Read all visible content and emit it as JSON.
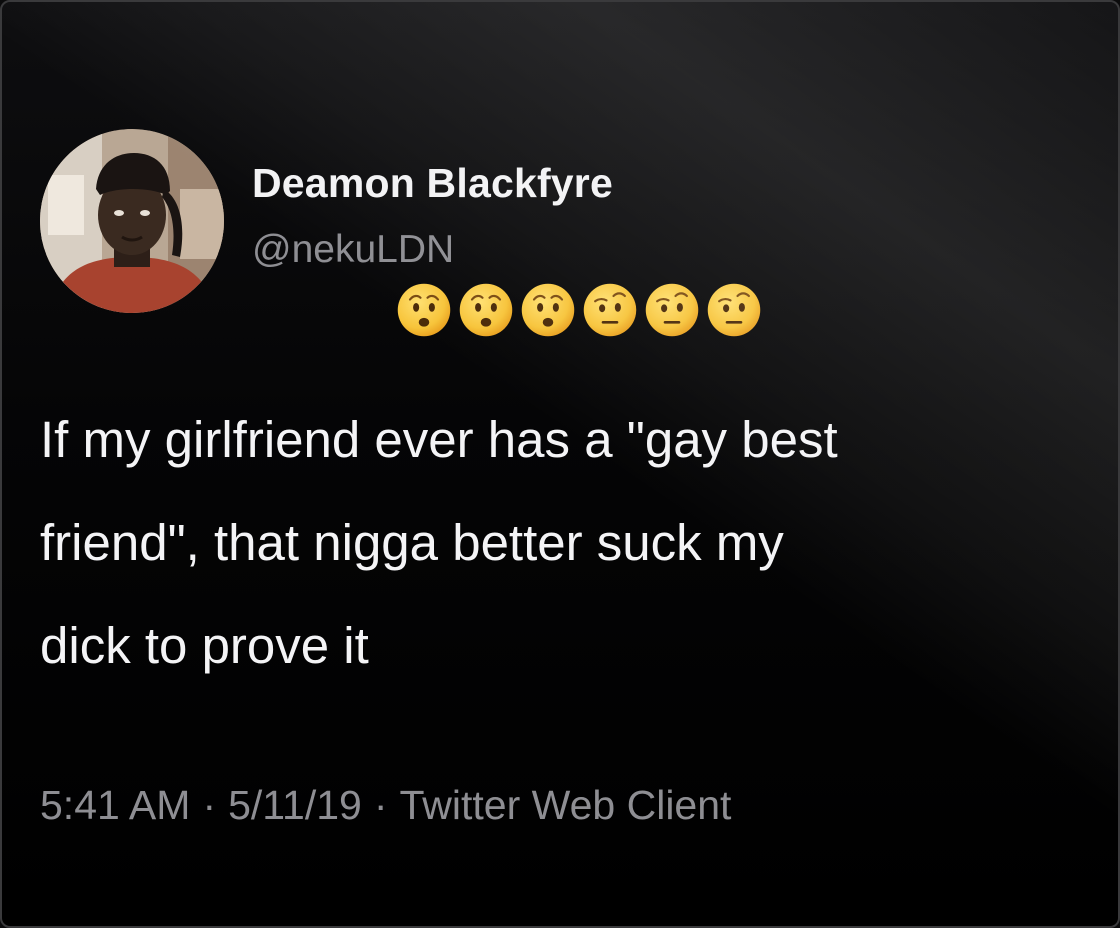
{
  "tweet": {
    "author": {
      "display_name": "Deamon Blackfyre",
      "handle": "@nekuLDN"
    },
    "emoji": [
      "hushed-face-emoji",
      "hushed-face-emoji",
      "hushed-face-emoji",
      "face-with-raised-eyebrow-emoji",
      "face-with-raised-eyebrow-emoji",
      "face-with-raised-eyebrow-emoji"
    ],
    "text": "If my girlfriend ever has a \"gay best\nfriend\", that nigga better suck my\ndick to prove it",
    "meta": {
      "time": "5:41 AM",
      "date": "5/11/19",
      "source": "Twitter Web Client",
      "separator": "·"
    }
  },
  "colors": {
    "background": "#000000",
    "text": "#f4f4f6",
    "secondary_text": "#8e8e93",
    "emoji_face": "#f7c43a"
  }
}
